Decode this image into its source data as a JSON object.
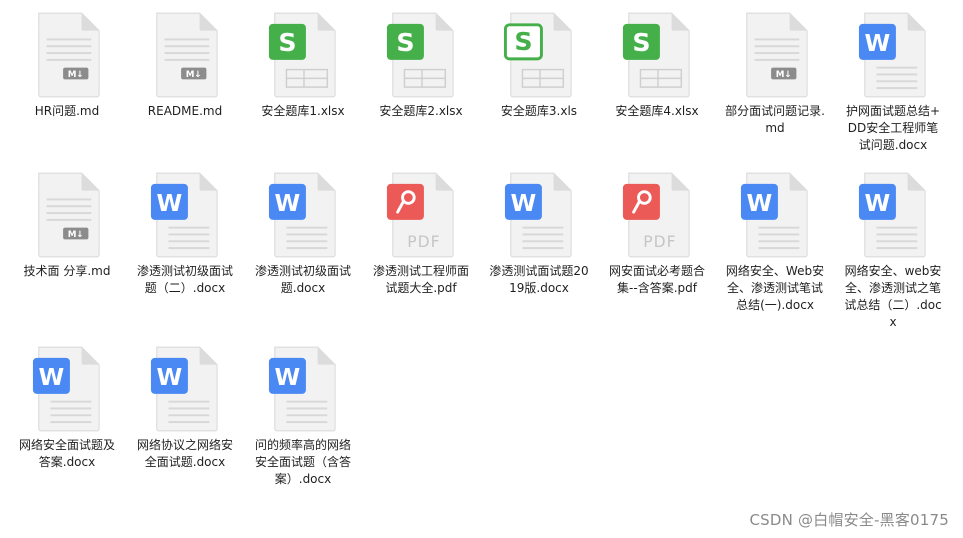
{
  "colors": {
    "page_fold": "#e6e6e6",
    "page_body": "#f3f3f3",
    "md_badge": "#8c8c8c",
    "sheet_green": "#45b04a",
    "word_blue": "#4a89f4",
    "pdf_red": "#ec5a57"
  },
  "files": [
    {
      "name": "HR问题.md",
      "type": "md",
      "icon": "markdown-file-icon"
    },
    {
      "name": "README.md",
      "type": "md",
      "icon": "markdown-file-icon"
    },
    {
      "name": "安全题库1.xlsx",
      "type": "xlsx",
      "icon": "spreadsheet-file-icon"
    },
    {
      "name": "安全题库2.xlsx",
      "type": "xlsx",
      "icon": "spreadsheet-file-icon"
    },
    {
      "name": "安全题库3.xls",
      "type": "xls",
      "icon": "spreadsheet-file-icon"
    },
    {
      "name": "安全题库4.xlsx",
      "type": "xlsx",
      "icon": "spreadsheet-file-icon"
    },
    {
      "name": "部分面试问题记录.md",
      "type": "md",
      "icon": "markdown-file-icon"
    },
    {
      "name": "护网面试题总结+DD安全工程师笔试问题.docx",
      "type": "docx",
      "icon": "word-file-icon"
    },
    {
      "name": "技术面 分享.md",
      "type": "md",
      "icon": "markdown-file-icon"
    },
    {
      "name": "渗透测试初级面试题（二）.docx",
      "type": "docx",
      "icon": "word-file-icon"
    },
    {
      "name": "渗透测试初级面试题.docx",
      "type": "docx",
      "icon": "word-file-icon"
    },
    {
      "name": "渗透测试工程师面试题大全.pdf",
      "type": "pdf",
      "icon": "pdf-file-icon"
    },
    {
      "name": "渗透测试面试题2019版.docx",
      "type": "docx",
      "icon": "word-file-icon"
    },
    {
      "name": "网安面试必考题合集--含答案.pdf",
      "type": "pdf",
      "icon": "pdf-file-icon"
    },
    {
      "name": "网络安全、Web安全、渗透测试笔试总结(一).docx",
      "type": "docx",
      "icon": "word-file-icon"
    },
    {
      "name": "网络安全、web安全、渗透测试之笔试总结（二）.docx",
      "type": "docx",
      "icon": "word-file-icon"
    },
    {
      "name": "网络安全面试题及答案.docx",
      "type": "docx",
      "icon": "word-file-icon"
    },
    {
      "name": "网络协议之网络安全面试题.docx",
      "type": "docx",
      "icon": "word-file-icon"
    },
    {
      "name": "问的频率高的网络安全面试题（含答案）.docx",
      "type": "docx",
      "icon": "word-file-icon"
    }
  ],
  "icon_text": {
    "md_badge": "M↓",
    "pdf_label": "PDF",
    "sheet_letter": "S",
    "word_letter": "W"
  },
  "watermark": "CSDN @白帽安全-黑客0175"
}
